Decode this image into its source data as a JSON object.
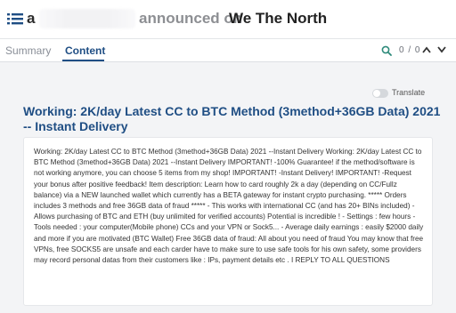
{
  "header": {
    "title_prefix": "a",
    "title_action": "announced on",
    "title_forum": "We The North"
  },
  "tabs": [
    {
      "label": "Summary",
      "active": false
    },
    {
      "label": "Content",
      "active": true
    }
  ],
  "search": {
    "match_count": "0 / 0"
  },
  "translate": {
    "label": "Translate",
    "enabled": false
  },
  "post": {
    "title": "Working: 2K/day Latest CC to BTC Method (3method+36GB Data) 2021 -- Instant Delivery",
    "body": "Working: 2K/day Latest CC to BTC Method (3method+36GB Data) 2021 --Instant Delivery Working: 2K/day Latest CC to BTC Method (3method+36GB Data) 2021 --Instant Delivery IMPORTANT! -100% Guarantee! if the method/software is not working anymore, you can choose 5 items from my shop! IMPORTANT! -Instant Delivery! IMPORTANT! -Request your bonus after positive feedback! Item description: Learn how to card roughly 2k a day (depending on CC/Fullz balance) via a NEW launched wallet which currently has a BETA gateway for instant crypto purchasing. ***** Orders includes 3 methods and free 36GB data of fraud ***** - This works with international CC (and has 20+ BINs included) - Allows purchasing of BTC and ETH (buy unlimited for verified accounts) Potential is incredible ! - Settings : few hours - Tools needed : your computer(Mobile phone) CCs and your VPN or Sock5... - Average daily earnings : easily $2000 daily and more if you are motivated (BTC Wallet) Free 36GB data of fraud: All about you need of fraud You may know that free VPNs, free SOCKS5 are unsafe and each carder have to make sure to use safe tools for his own safety, some providers may record personal datas from their customers like : IPs, payment details etc . I REPLY TO ALL QUESTIONS"
  },
  "colors": {
    "accent": "#1f4e84",
    "background": "#f3f4f6",
    "muted": "#8d8f93",
    "search_icon": "#2d8a7a"
  },
  "icons": {
    "menu": "list-menu-icon",
    "search": "search-icon",
    "up": "chevron-up-icon",
    "down": "chevron-down-icon"
  }
}
